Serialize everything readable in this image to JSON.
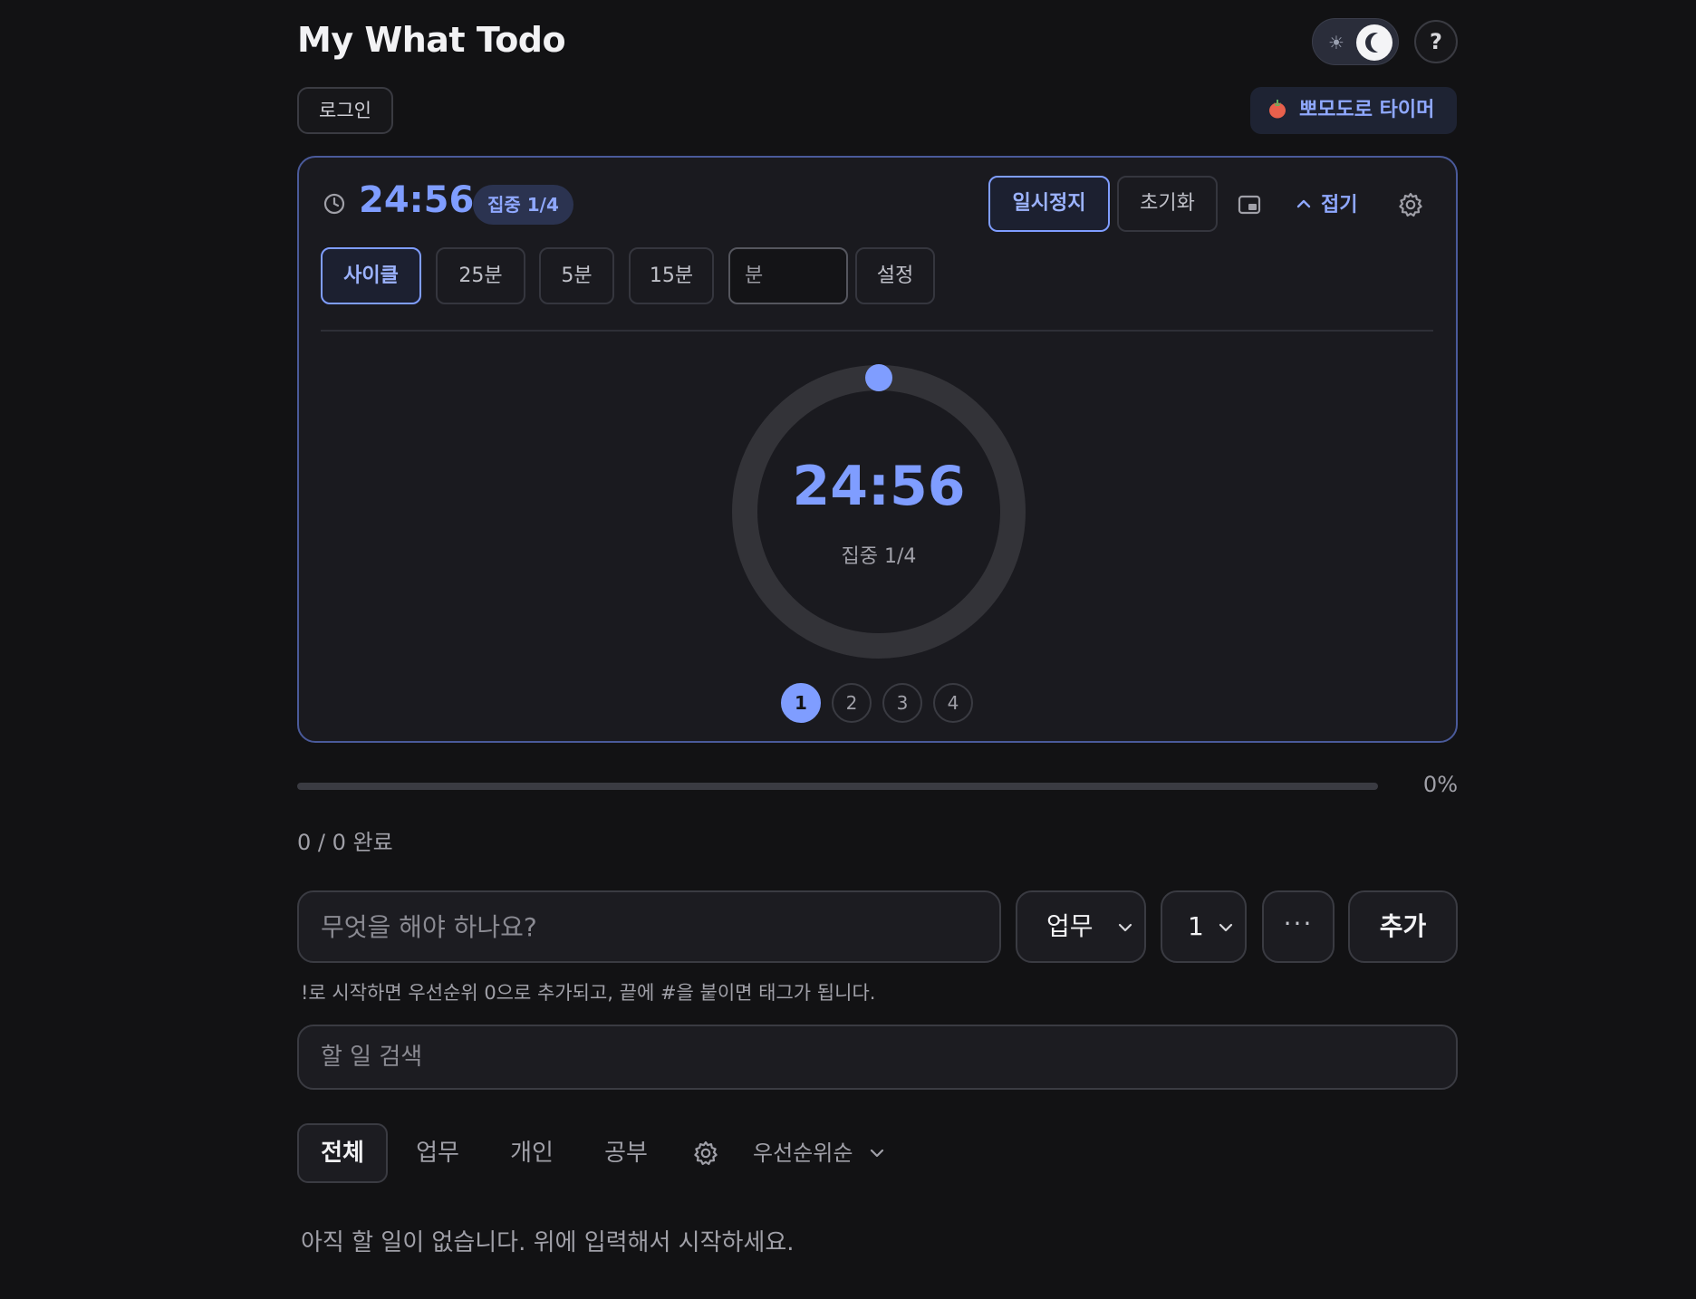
{
  "header": {
    "title": "My What Todo",
    "help_label": "?",
    "theme": "dark"
  },
  "auth": {
    "login_label": "로그인"
  },
  "pomodoro_toggle": {
    "label": "뽀모도로 타이머"
  },
  "timer": {
    "time": "24:56",
    "phase": "집중 1/4",
    "pause_label": "일시정지",
    "reset_label": "초기화",
    "collapse_label": "접기",
    "presets": [
      {
        "label": "사이클",
        "selected": true
      },
      {
        "label": "25분"
      },
      {
        "label": "5분"
      },
      {
        "label": "15분"
      }
    ],
    "custom_minutes_placeholder": "분",
    "settings_label": "설정",
    "progress_fraction": 0.0,
    "cycle_steps": [
      "1",
      "2",
      "3",
      "4"
    ],
    "active_step": 1
  },
  "progress": {
    "percent": 0,
    "percent_label": "0%",
    "done_label": "0 / 0 완료"
  },
  "new_task": {
    "placeholder": "무엇을 해야 하나요?",
    "category_value": "업무",
    "priority_value": "1",
    "more_label": "···",
    "add_label": "추가",
    "hint": "!로 시작하면 우선순위 0으로 추가되고, 끝에 #을 붙이면 태그가 됩니다."
  },
  "search": {
    "placeholder": "할 일 검색"
  },
  "filters": {
    "tabs": [
      {
        "label": "전체",
        "active": true
      },
      {
        "label": "업무"
      },
      {
        "label": "개인"
      },
      {
        "label": "공부"
      }
    ],
    "sort_label": "우선순위순"
  },
  "empty_message": "아직 할 일이 없습니다. 위에 입력해서 시작하세요.",
  "colors": {
    "background": "#121214",
    "accent": "#7f9dff",
    "panel_border": "#4a5a9a",
    "tomato": "#e8604c"
  }
}
